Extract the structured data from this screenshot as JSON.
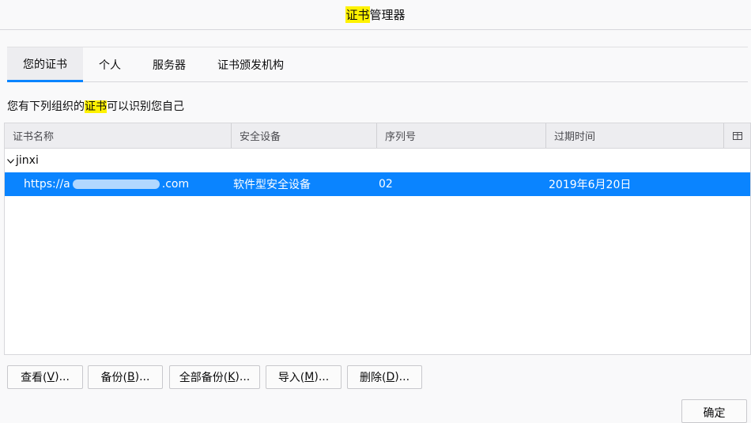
{
  "window": {
    "title_highlight": "证书",
    "title_rest": "管理器"
  },
  "tabs": [
    {
      "label": "您的证书",
      "active": true
    },
    {
      "label": "个人",
      "active": false
    },
    {
      "label": "服务器",
      "active": false
    },
    {
      "label": "证书颁发机构",
      "active": false
    }
  ],
  "description": {
    "before": "您有下列组织的",
    "highlight": "证书",
    "after": "可以识别您自己"
  },
  "table": {
    "columns": [
      "证书名称",
      "安全设备",
      "序列号",
      "过期时间"
    ],
    "picker_icon": "column-picker-icon",
    "groups": [
      {
        "name": "jinxi",
        "expanded": true,
        "rows": [
          {
            "name_prefix": "https://a",
            "name_suffix": ".com",
            "device": "软件型安全设备",
            "serial": "02",
            "expires": "2019年6月20日",
            "selected": true
          }
        ]
      }
    ]
  },
  "buttons": {
    "view": {
      "pre": "查看(",
      "key": "V",
      "post": ")..."
    },
    "backup": {
      "pre": "备份(",
      "key": "B",
      "post": ")..."
    },
    "backup_all": {
      "pre": "全部备份(",
      "key": "K",
      "post": ")..."
    },
    "import": {
      "pre": "导入(",
      "key": "M",
      "post": ")..."
    },
    "delete": {
      "pre": "删除(",
      "key": "D",
      "post": ")..."
    },
    "ok": "确定"
  },
  "colors": {
    "accent": "#0a84ff",
    "highlight": "#fff200"
  }
}
